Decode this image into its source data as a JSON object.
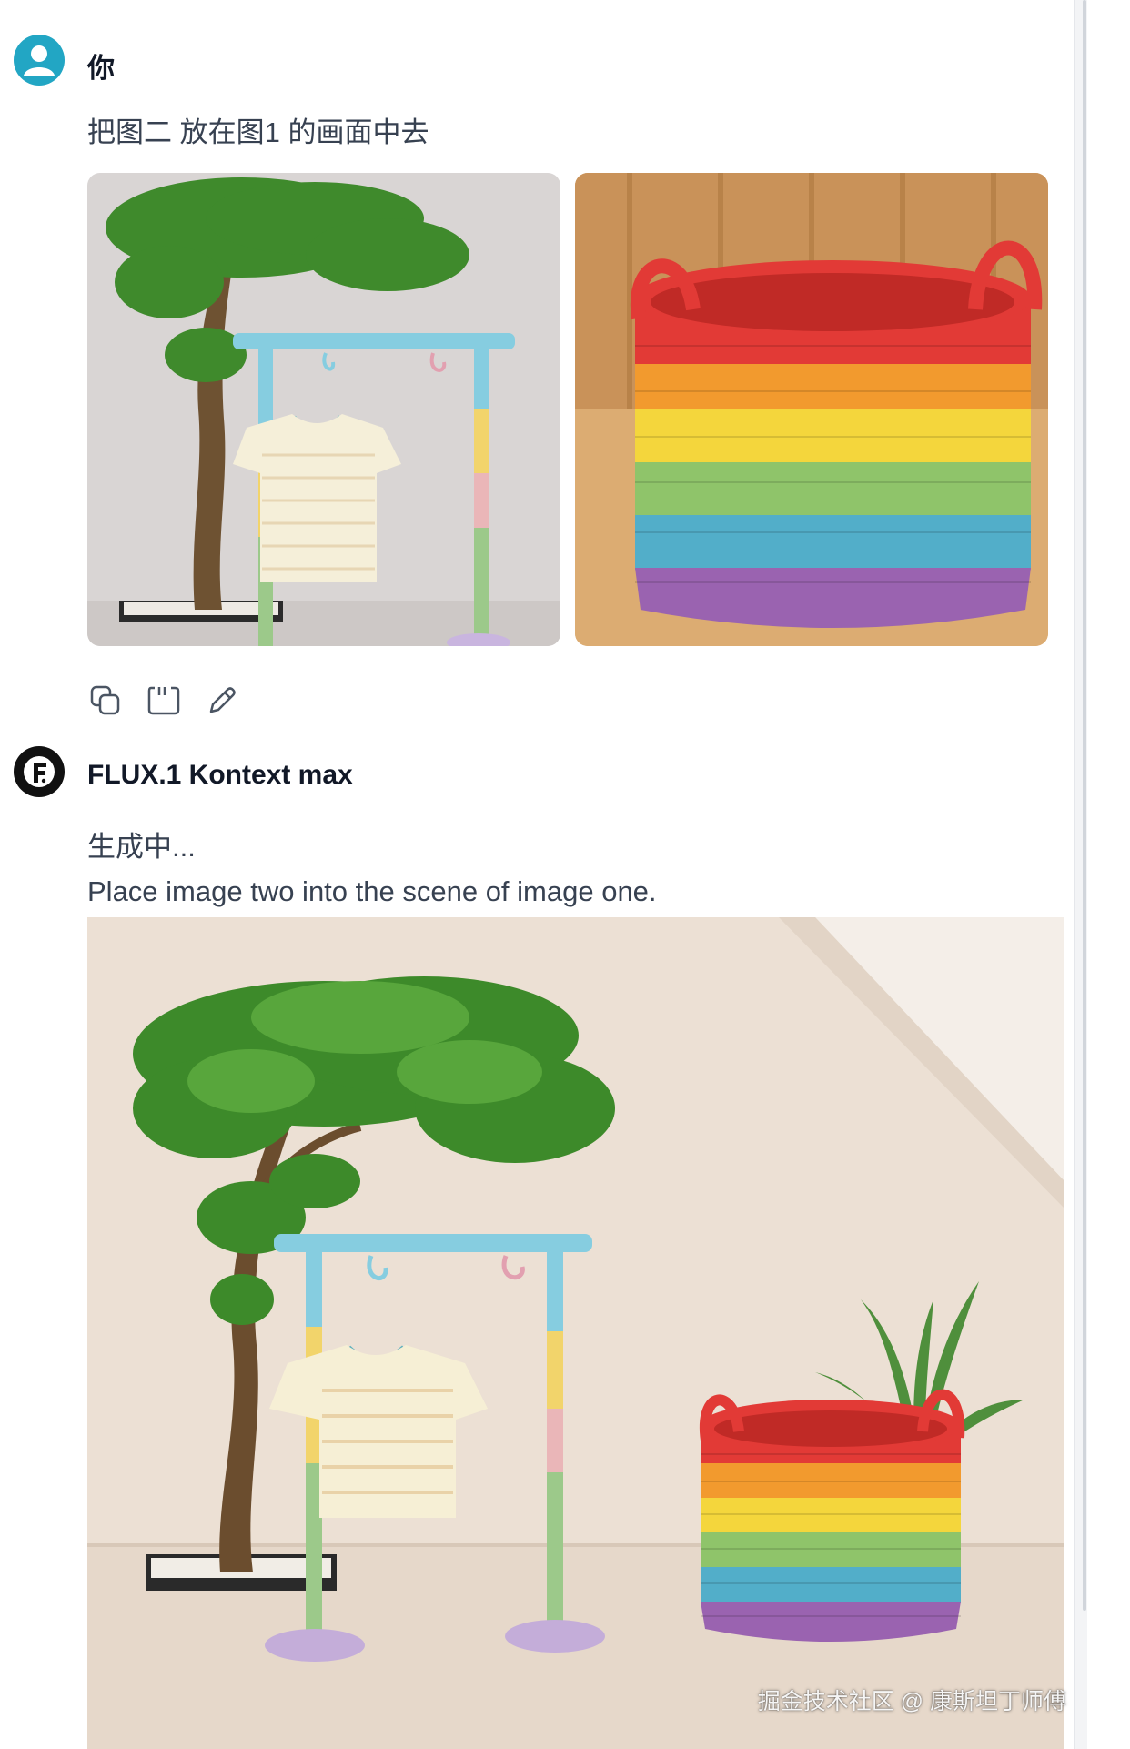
{
  "user_message": {
    "sender": "你",
    "text": "把图二 放在图1 的画面中去",
    "attachments": [
      "image-1-tree-clothes-rack",
      "image-2-rainbow-basket"
    ],
    "actions": [
      "copy-icon",
      "quote-icon",
      "edit-icon"
    ]
  },
  "assistant_message": {
    "sender": "FLUX.1 Kontext max",
    "avatar_letter": "F",
    "status": "生成中...",
    "prompt": "Place image two into the scene of image one.",
    "result_image": "generated-scene-tree-rack-basket"
  },
  "watermark": "掘金技术社区 @ 康斯坦丁师傅",
  "colors": {
    "user_avatar": "#22a6c4",
    "assistant_avatar": "#111111",
    "rack_blue": "#86cde0",
    "basket_red": "#e23a36"
  }
}
